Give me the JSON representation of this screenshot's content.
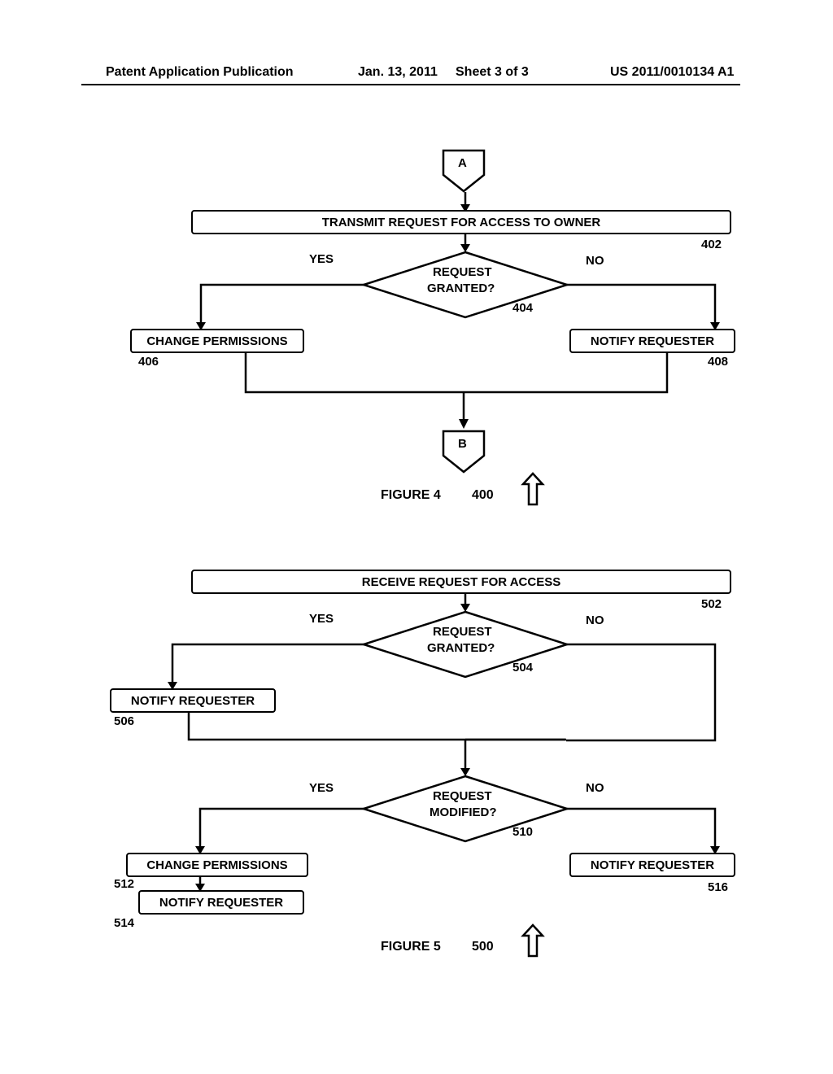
{
  "header": {
    "left": "Patent Application Publication",
    "date": "Jan. 13, 2011",
    "sheet": "Sheet 3 of 3",
    "pubno": "US 2011/0010134 A1"
  },
  "fig4": {
    "connectorA": "A",
    "box402": "TRANSMIT REQUEST FOR ACCESS TO OWNER",
    "ref402": "402",
    "decision": "REQUEST GRANTED?",
    "ref404": "404",
    "yes": "YES",
    "no": "NO",
    "box406": "CHANGE PERMISSIONS",
    "ref406": "406",
    "box408": "NOTIFY REQUESTER",
    "ref408": "408",
    "connectorB": "B",
    "caption": "FIGURE 4",
    "fignum": "400"
  },
  "fig5": {
    "box502": "RECEIVE REQUEST FOR ACCESS",
    "ref502": "502",
    "decision1": "REQUEST GRANTED?",
    "ref504": "504",
    "yes": "YES",
    "no": "NO",
    "box506": "NOTIFY REQUESTER",
    "ref506": "506",
    "decision2": "REQUEST MODIFIED?",
    "ref510": "510",
    "box512": "CHANGE PERMISSIONS",
    "ref512": "512",
    "box514": "NOTIFY REQUESTER",
    "ref514": "514",
    "box516": "NOTIFY REQUESTER",
    "ref516": "516",
    "caption": "FIGURE 5",
    "fignum": "500"
  }
}
